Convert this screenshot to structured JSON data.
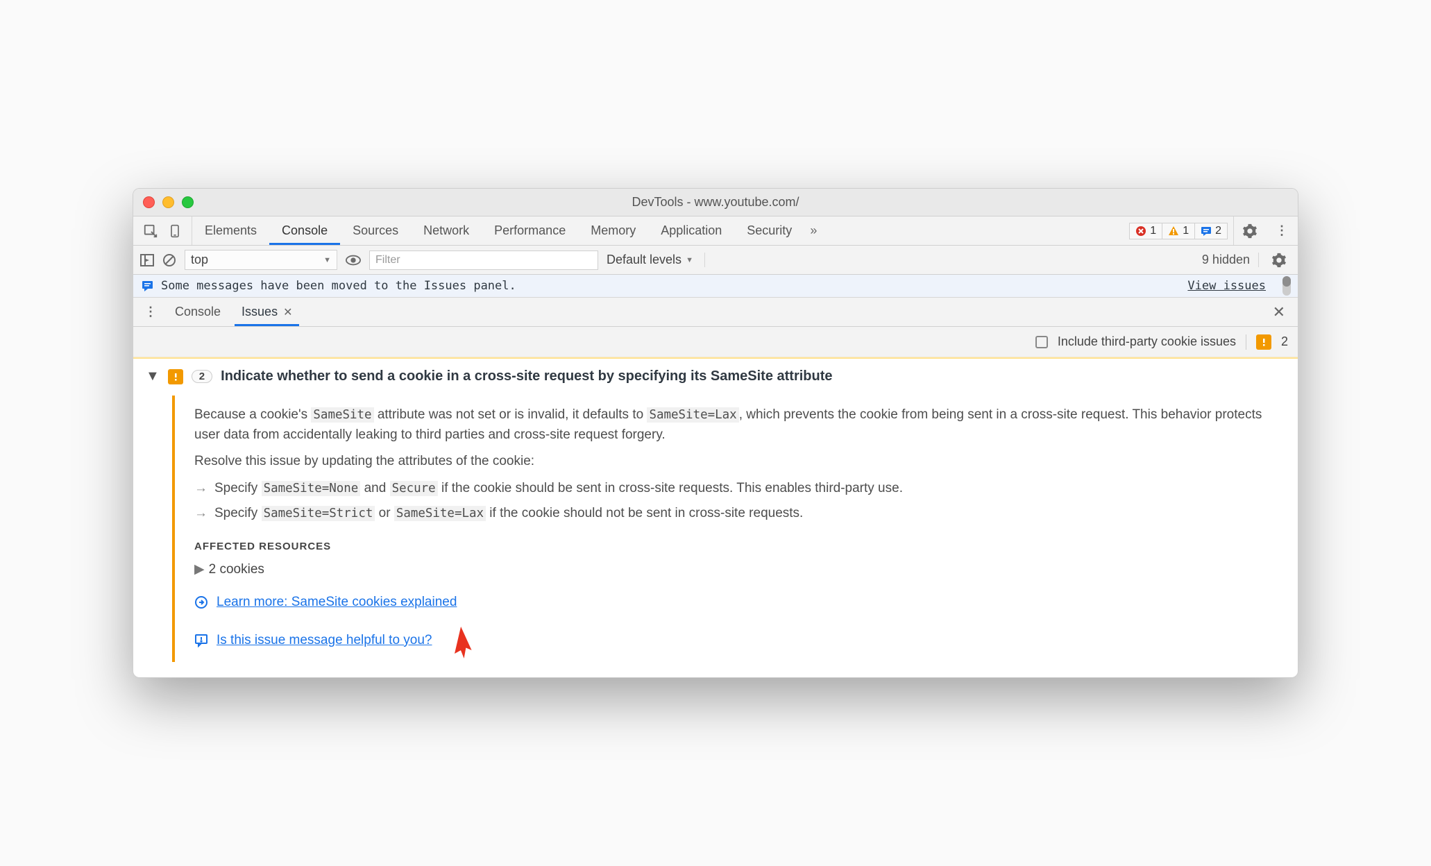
{
  "window": {
    "title": "DevTools - www.youtube.com/"
  },
  "mainTabs": {
    "items": [
      {
        "label": "Elements"
      },
      {
        "label": "Console"
      },
      {
        "label": "Sources"
      },
      {
        "label": "Network"
      },
      {
        "label": "Performance"
      },
      {
        "label": "Memory"
      },
      {
        "label": "Application"
      },
      {
        "label": "Security"
      }
    ],
    "activeIndex": 1,
    "more": "»"
  },
  "counters": {
    "errors": "1",
    "warnings": "1",
    "info": "2"
  },
  "consoleBar": {
    "context": "top",
    "filterPlaceholder": "Filter",
    "levelsLabel": "Default levels",
    "hiddenLabel": "9 hidden"
  },
  "infoBar": {
    "message": "Some messages have been moved to the Issues panel.",
    "link": "View issues"
  },
  "drawer": {
    "tabs": [
      {
        "label": "Console"
      },
      {
        "label": "Issues"
      }
    ],
    "activeIndex": 1
  },
  "issuesBar": {
    "checkboxLabel": "Include third-party cookie issues",
    "count": "2"
  },
  "issue": {
    "count": "2",
    "title": "Indicate whether to send a cookie in a cross-site request by specifying its SameSite attribute",
    "p1a": "Because a cookie's ",
    "c1": "SameSite",
    "p1b": " attribute was not set or is invalid, it defaults to ",
    "c2": "SameSite=Lax",
    "p1c": ", which prevents the cookie from being sent in a cross-site request. This behavior protects user data from accidentally leaking to third parties and cross-site request forgery.",
    "p2": "Resolve this issue by updating the attributes of the cookie:",
    "s1a": "Specify ",
    "s1c1": "SameSite=None",
    "s1b": " and ",
    "s1c2": "Secure",
    "s1c": " if the cookie should be sent in cross-site requests. This enables third-party use.",
    "s2a": "Specify ",
    "s2c1": "SameSite=Strict",
    "s2b": " or ",
    "s2c2": "SameSite=Lax",
    "s2c": " if the cookie should not be sent in cross-site requests.",
    "resourcesHeader": "AFFECTED RESOURCES",
    "cookies": "2 cookies",
    "learnMore": "Learn more: SameSite cookies explained",
    "feedback": "Is this issue message helpful to you?"
  }
}
